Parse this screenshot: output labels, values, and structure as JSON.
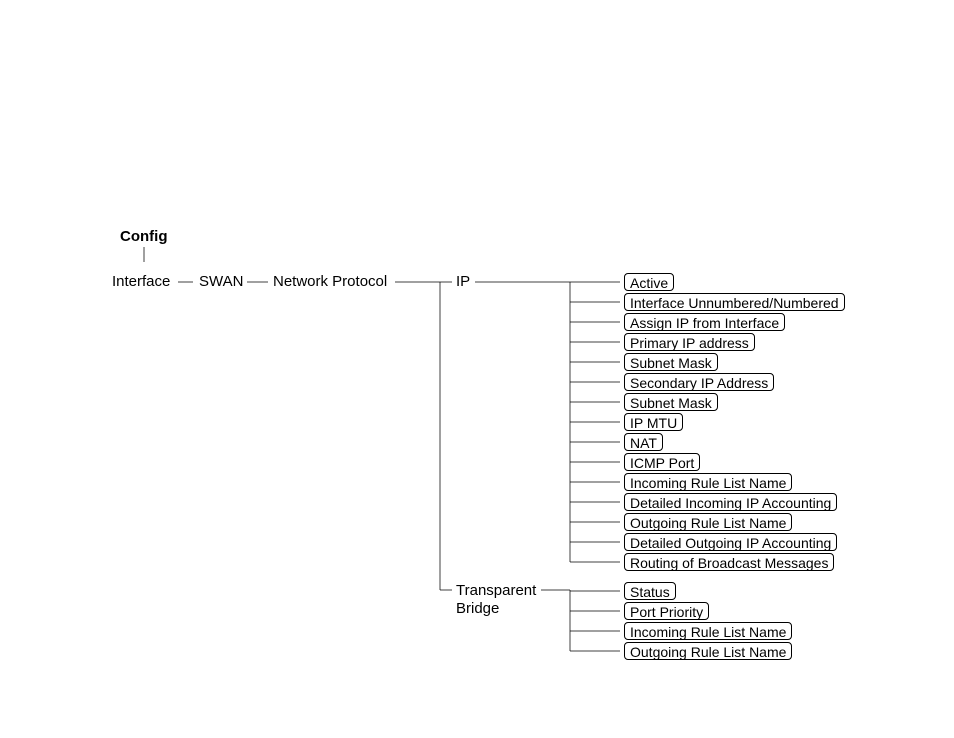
{
  "root": "Config",
  "path": {
    "interface": "Interface",
    "swan": "SWAN",
    "network_protocol": "Network Protocol"
  },
  "ip": {
    "label": "IP",
    "items": [
      "Active",
      "Interface Unnumbered/Numbered",
      "Assign IP from Interface",
      "Primary IP address",
      "Subnet  Mask",
      "Secondary IP Address",
      "Subnet  Mask",
      "IP MTU",
      "NAT",
      "ICMP Port",
      "Incoming Rule List Name",
      "Detailed Incoming IP Accounting",
      "Outgoing Rule List Name",
      "Detailed Outgoing IP Accounting",
      "Routing of Broadcast Messages"
    ]
  },
  "bridge": {
    "label_l1": "Transparent",
    "label_l2": "Bridge",
    "items": [
      "Status",
      "Port Priority",
      "Incoming Rule List Name",
      "Outgoing Rule List Name"
    ]
  }
}
